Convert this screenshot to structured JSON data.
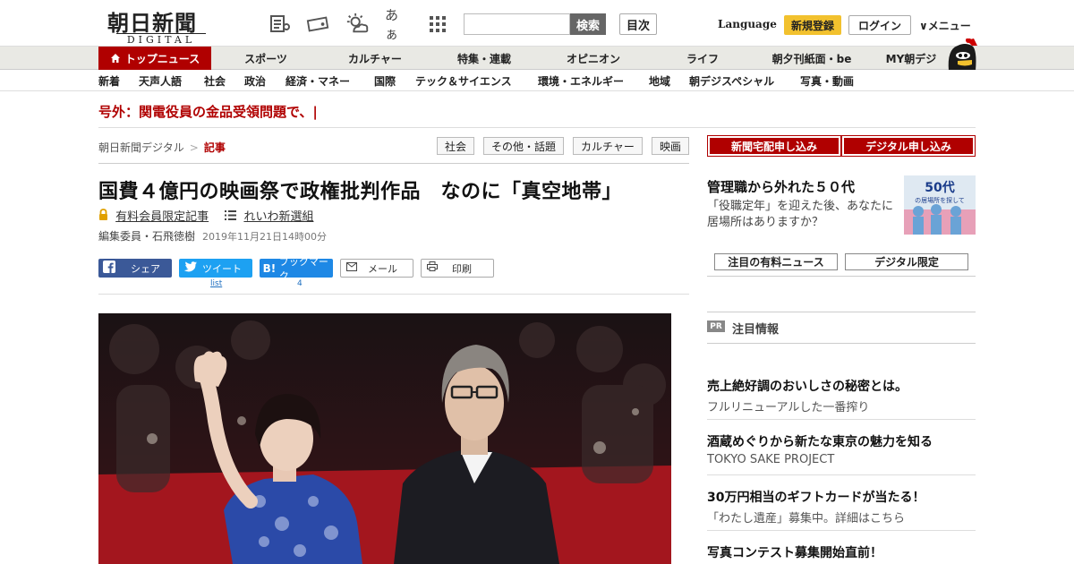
{
  "header": {
    "logo_jp": "朝日新聞",
    "logo_en": "DIGITAL",
    "search_button": "検索",
    "search_placeholder": "",
    "toc_button": "目次",
    "language": "Language",
    "register": "新規登録",
    "login": "ログイン",
    "menu": "∨メニュー",
    "font_toggle": "あぁ"
  },
  "nav_main": [
    "トップニュース",
    "スポーツ",
    "カルチャー",
    "特集・連載",
    "オピニオン",
    "ライフ",
    "朝夕刊紙面・be",
    "MY朝デジ"
  ],
  "nav_sub": [
    "新着",
    "天声人語",
    "社会",
    "政治",
    "経済・マネー",
    "国際",
    "テック＆サイエンス",
    "環境・エネルギー",
    "地域",
    "朝デジスペシャル",
    "写真・動画"
  ],
  "breaking": "号外：関電役員の金品受領問題で、|",
  "breadcrumb": {
    "home": "朝日新聞デジタル",
    "sep": ">",
    "current": "記事"
  },
  "tags": [
    "社会",
    "その他・話題",
    "カルチャー",
    "映画"
  ],
  "article": {
    "headline": "国費４億円の映画祭で政権批判作品　なのに「真空地帯」",
    "member_only": "有料会員限定記事",
    "series": "れいわ新選組",
    "author": "編集委員・石飛徳樹",
    "date": "2019年11月21日14時00分"
  },
  "share": {
    "facebook": "シェア",
    "twitter": "ツイート",
    "twitter_count": "list",
    "hatena": "ブックマーク",
    "hatena_icon": "B!",
    "hatena_count": "4",
    "mail": "メール",
    "print": "印刷"
  },
  "sidebar": {
    "subscribe_paper": "新聞宅配申し込み",
    "subscribe_digital": "デジタル申し込み",
    "promo_title": "管理職から外れた５０代",
    "promo_text": "「役職定年」を迎えた後、あなたに居場所はありますか？",
    "promo_img_big": "50代",
    "promo_img_small": "の居場所を探して",
    "tab_paid": "注目の有料ニュース",
    "tab_digital": "デジタル限定",
    "pr_badge": "PR",
    "pr_label": "注目情報",
    "pr_items": [
      {
        "title": "売上絶好調のおいしさの秘密とは。",
        "sub": "フルリニューアルした一番搾り"
      },
      {
        "title": "酒蔵めぐりから新たな東京の魅力を知る",
        "sub": "TOKYO SAKE PROJECT"
      },
      {
        "title": "30万円相当のギフトカードが当たる！",
        "sub": "「わたし遺産」募集中。詳細はこちら"
      },
      {
        "title": "写真コンテスト募集開始直前！",
        "sub": ""
      }
    ]
  },
  "colors": {
    "brand_red": "#b00000",
    "accent_yellow": "#f2c12e",
    "facebook": "#3b5998",
    "twitter": "#1da1f2",
    "hatena": "#1e88e5"
  }
}
